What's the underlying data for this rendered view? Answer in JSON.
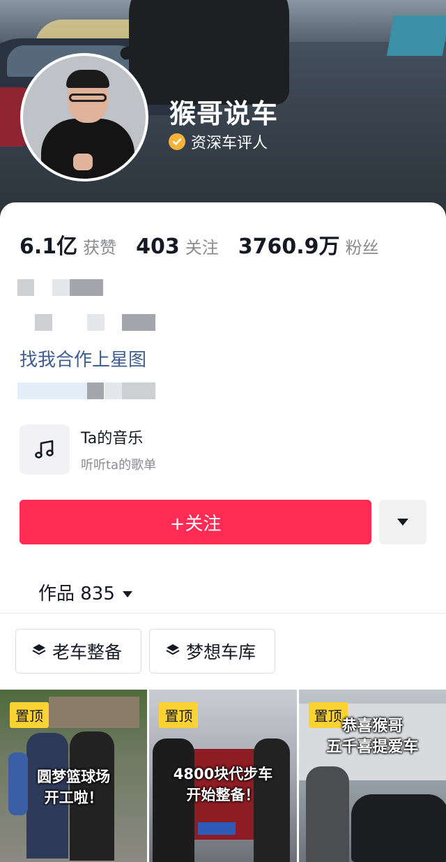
{
  "profile": {
    "name": "猴哥说车",
    "verified_label": "资深车评人"
  },
  "stats": [
    {
      "value": "6.1亿",
      "label": "获赞"
    },
    {
      "value": "403",
      "label": "关注"
    },
    {
      "value": "3760.9万",
      "label": "粉丝"
    }
  ],
  "cooperation_link": "找我合作上星图",
  "music": {
    "title": "Ta的音乐",
    "subtitle": "听听ta的歌单",
    "icon": "music-note-icon"
  },
  "follow_label": "+关注",
  "works": {
    "label": "作品 835"
  },
  "collections": [
    {
      "label": "老车整备",
      "icon": "layers-icon"
    },
    {
      "label": "梦想车库",
      "icon": "layers-icon"
    }
  ],
  "videos": [
    {
      "pin": "置顶",
      "caption_line1": "圆梦篮球场",
      "caption_line2": "开工啦！"
    },
    {
      "pin": "置顶",
      "caption_line1": "4800块代步车",
      "caption_line2": "开始整备！"
    },
    {
      "pin": "置顶",
      "caption_line1": "恭喜猴哥",
      "caption_line2": "五千喜提爱车"
    }
  ],
  "colors": {
    "primary": "#fe2c55",
    "link": "#3f5e90",
    "pin_badge": "#fcd333",
    "verified_badge": "#f6b23a"
  }
}
